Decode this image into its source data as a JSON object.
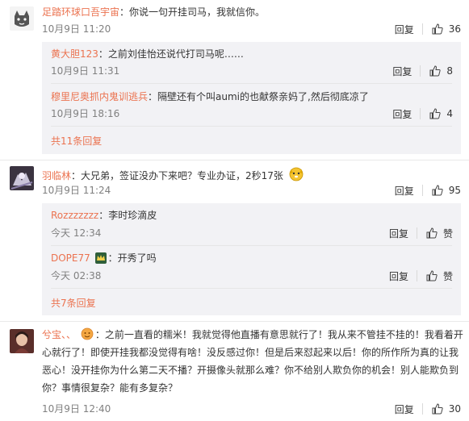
{
  "comments": [
    {
      "user": "足踏环球口吾宇宙",
      "text": "：你说一句开挂司马，我就信你。",
      "time": "10月9日 11:20",
      "reply_label": "回复",
      "likes": "36",
      "replies": [
        {
          "user": "黄大胆123",
          "text": "：之前刘佳怡还说代打司马呢……",
          "time": "10月9日 11:31",
          "likes": "8"
        },
        {
          "user": "穆里尼奥抓内鬼训逃兵",
          "text": "：隔壁还有个叫aumi的也献祭亲妈了,然后彻底凉了",
          "time": "10月9日 18:16",
          "likes": "4"
        }
      ],
      "more": "共11条回复"
    },
    {
      "user": "羽临林",
      "text": "：大兄弟，签证没办下来吧？专业办证，2秒17张",
      "time": "10月9日 11:24",
      "reply_label": "回复",
      "likes": "95",
      "replies": [
        {
          "user": "Rozzzzzzz",
          "text": "：李时珍滴皮",
          "time": "今天 12:34",
          "likes": "赞"
        },
        {
          "user": "DOPE77",
          "text": "：开秀了吗",
          "time": "今天 02:38",
          "likes": "赞"
        }
      ],
      "more": "共7条回复"
    },
    {
      "user": "兮宝、、",
      "text": "：之前一直看的糯米！我就觉得他直播有意思就行了！我从来不管挂不挂的！我看着开心就行了！即使开挂我都没觉得有啥！没反感过你！但是后来怼起来以后！你的所作所为真的让我恶心！没开挂你为什么第二天不播？开摄像头就那么难？你不给别人欺负你的机会！别人能欺负到你？事情很复杂？能有多复杂？",
      "time": "10月9日 12:40",
      "reply_label": "回复",
      "likes": "30"
    }
  ],
  "colors": {
    "username": "#eb7350",
    "meta": "#808080",
    "subbg": "#f2f2f5"
  },
  "icons": {
    "like": "thumbs-up-icon",
    "emoji": "dog-face-emoji",
    "badge": "crown-badge-icon"
  }
}
